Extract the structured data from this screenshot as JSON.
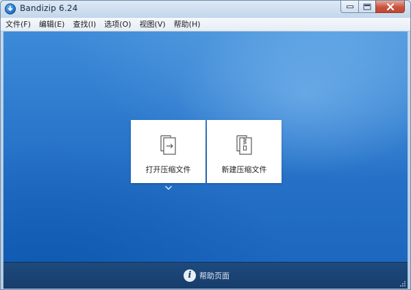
{
  "window": {
    "title": "Bandizip 6.24"
  },
  "menubar": {
    "items": [
      {
        "label": "文件(F)"
      },
      {
        "label": "编辑(E)"
      },
      {
        "label": "查找(I)"
      },
      {
        "label": "选项(O)"
      },
      {
        "label": "视图(V)"
      },
      {
        "label": "帮助(H)"
      }
    ]
  },
  "main": {
    "open_archive_label": "打开压缩文件",
    "new_archive_label": "新建压缩文件"
  },
  "footer": {
    "help_label": "帮助页面"
  },
  "icons": {
    "app": "bandizip-logo-icon",
    "open": "open-archive-icon",
    "new": "new-archive-icon",
    "dropdown": "chevron-down-icon",
    "info": "info-icon"
  },
  "colors": {
    "background_blue": "#2a76cb",
    "footer_bar": "#1e4a7e",
    "close_button": "#c8553f"
  }
}
